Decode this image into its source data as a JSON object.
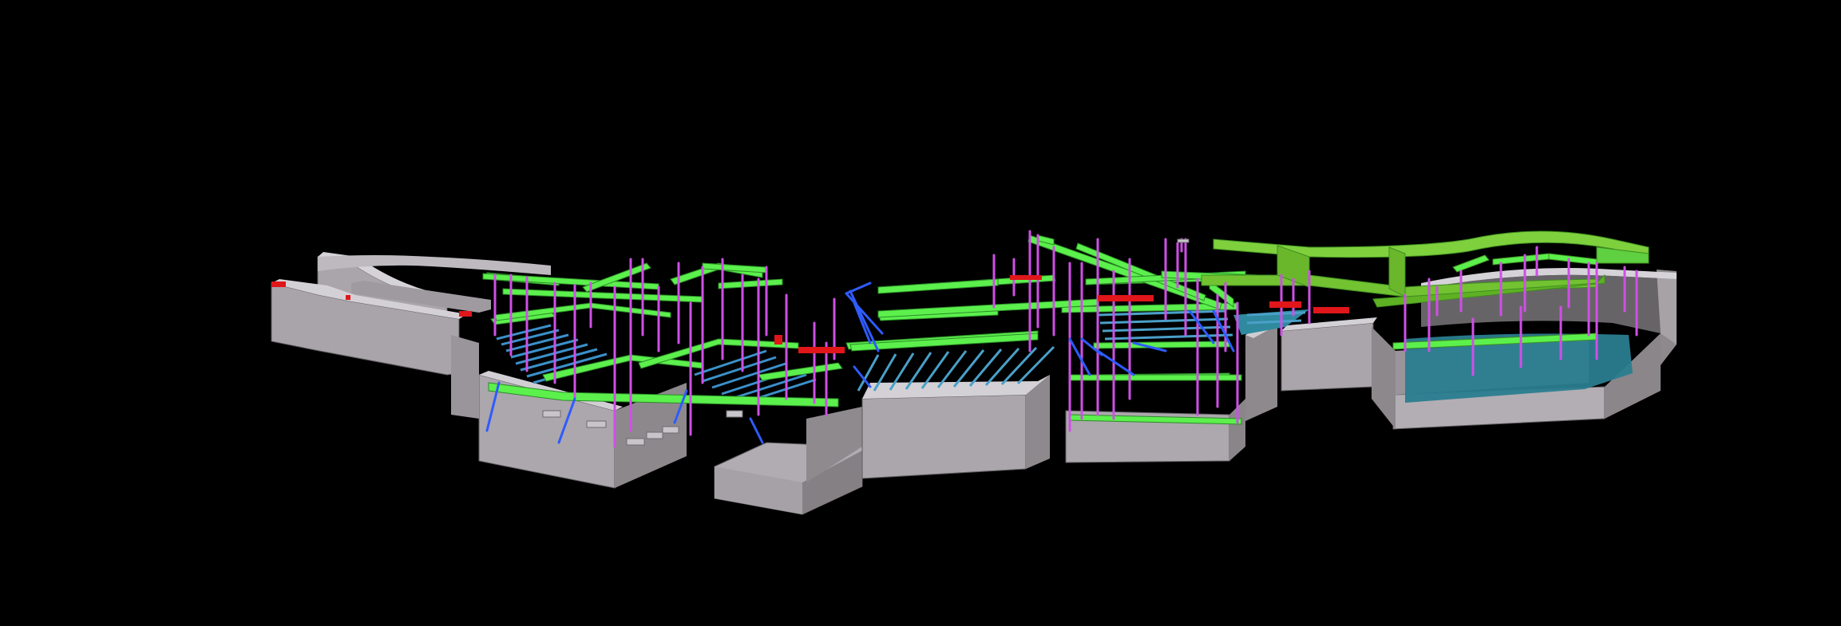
{
  "viewport": {
    "background": "#000000",
    "view": "3d-isometric-structural-model"
  },
  "palette": {
    "wall_top": "#d3d0d5",
    "wall_front": "#aaa6ab",
    "wall_side": "#8a8589",
    "beam": "#5ef04e",
    "beam_dark": "#2ea02a",
    "beam_roof": "#7fd03d",
    "column": "#cf4fe6",
    "brace": "#2f5bff",
    "joist": "#3a8ec8",
    "slab": "#2d8296",
    "red_member": "#e0161a"
  }
}
